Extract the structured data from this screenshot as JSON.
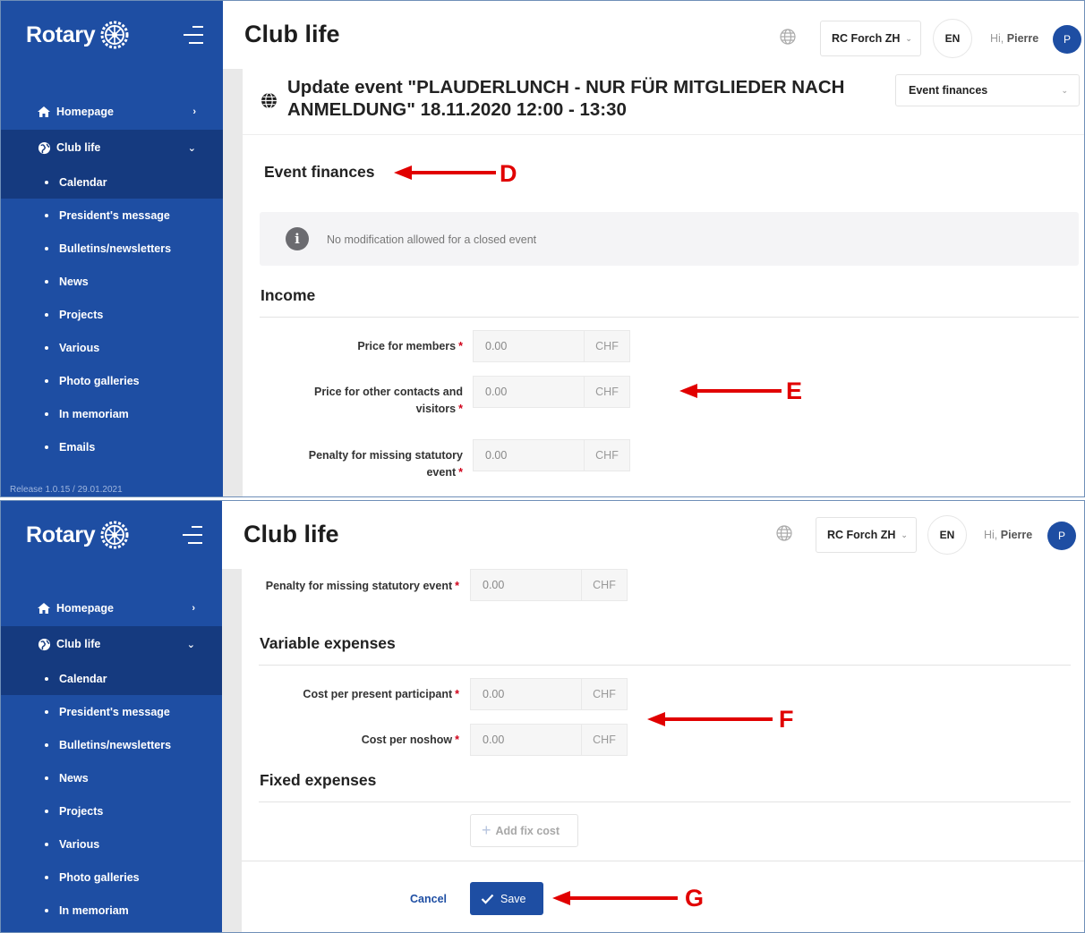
{
  "brand": {
    "name": "Rotary",
    "release": "Release 1.0.15 / 29.01.2021",
    "accent": "#1e4ea3",
    "sidebar_dark": "#153a7f"
  },
  "header": {
    "title": "Club life",
    "club": "RC Forch ZH",
    "language": "EN",
    "greeting_prefix": "Hi,",
    "user": "Pierre",
    "avatar_initial": "P"
  },
  "sidebar": {
    "homepage": "Homepage",
    "club_life": "Club life",
    "sub_items": [
      "Calendar",
      "President's message",
      "Bulletins/newsletters",
      "News",
      "Projects",
      "Various",
      "Photo galleries",
      "In memoriam",
      "Emails"
    ]
  },
  "event": {
    "title": "Update event \"PLAUDERLUNCH - NUR FÜR MITGLIEDER NACH ANMELDUNG\" 18.11.2020 12:00 - 13:30",
    "tab_select": "Event finances"
  },
  "finances": {
    "heading": "Event finances",
    "notice": "No modification allowed for a closed event",
    "income": {
      "heading": "Income",
      "fields": [
        {
          "label": "Price for members",
          "value": "0.00",
          "unit": "CHF"
        },
        {
          "label": "Price for other contacts and visitors",
          "value": "0.00",
          "unit": "CHF"
        },
        {
          "label": "Penalty for missing statutory event",
          "value": "0.00",
          "unit": "CHF"
        }
      ]
    },
    "variable_expenses": {
      "heading": "Variable expenses",
      "fields": [
        {
          "label": "Cost per present participant",
          "value": "0.00",
          "unit": "CHF"
        },
        {
          "label": "Cost per noshow",
          "value": "0.00",
          "unit": "CHF"
        }
      ]
    },
    "fixed_expenses": {
      "heading": "Fixed expenses",
      "add_label": "Add fix cost"
    },
    "cancel_label": "Cancel",
    "save_label": "Save"
  },
  "annotations": {
    "d": "D",
    "e": "E",
    "f": "F",
    "g": "G",
    "color": "#e10000"
  }
}
